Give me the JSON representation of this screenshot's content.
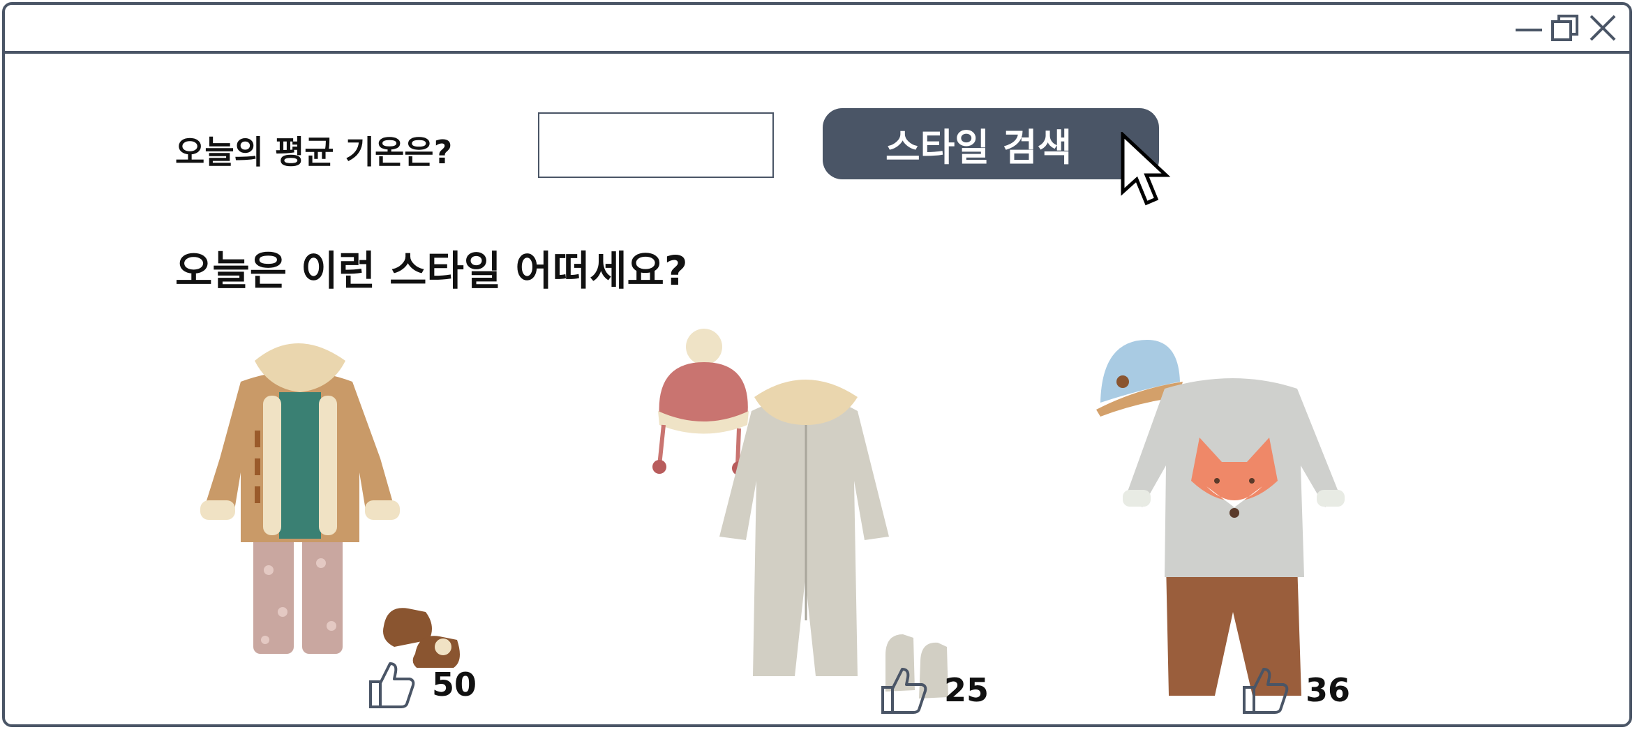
{
  "window": {
    "controls": [
      "minimize-icon",
      "restore-icon",
      "close-icon"
    ]
  },
  "search": {
    "question_label": "오늘의 평균 기온은?",
    "input_value": "",
    "button_label": "스타일 검색"
  },
  "recommendations": {
    "headline": "오늘은 이런 스타일 어떠세요?",
    "items": [
      {
        "name": "duffle-coat-outfit",
        "likes": "50"
      },
      {
        "name": "snowsuit-outfit",
        "likes": "25"
      },
      {
        "name": "fox-sweater-outfit",
        "likes": "36"
      }
    ]
  },
  "colors": {
    "frame": "#4a5566",
    "button_bg": "#4a5566",
    "button_text": "#ffffff"
  }
}
